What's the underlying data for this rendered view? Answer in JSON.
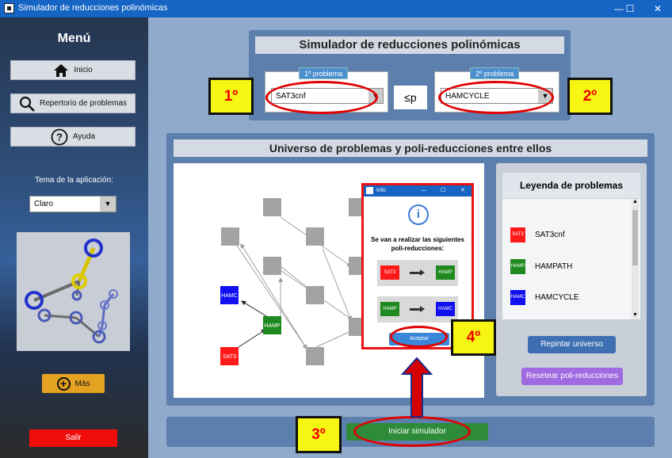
{
  "window": {
    "title": "Simulador de reducciones polinómicas",
    "controls": [
      "—",
      "☐",
      "✕"
    ]
  },
  "sidebar": {
    "title": "Menú",
    "buttons": [
      {
        "label": "Inicio",
        "icon": "home-icon"
      },
      {
        "label": "Repertorio de problemas",
        "icon": "search-icon"
      },
      {
        "label": "Ayuda",
        "icon": "help-icon"
      }
    ],
    "theme_label": "Tema de la aplicación:",
    "theme_value": "Claro",
    "more_label": "Más",
    "exit_label": "Salir"
  },
  "top_panel": {
    "title": "Simulador de reducciones polinómicas",
    "problem1_tag": "1º problema",
    "problem1_value": "SAT3cnf",
    "reduction_symbol": "≤p",
    "problem2_tag": "2º problema",
    "problem2_value": "HAMCYCLE"
  },
  "universe": {
    "title": "Universo de problemas y poli-reducciones entre ellos",
    "nodes": {
      "hamc": "HAMC",
      "hamp": "HAMP",
      "sat3": "SAT3"
    }
  },
  "legend": {
    "title": "Leyenda de problemas",
    "items": [
      {
        "abbr": "SAT3",
        "label": "SAT3cnf",
        "color": "#ff1a1a"
      },
      {
        "abbr": "HAMP",
        "label": "HAMPATH",
        "color": "#1f8a1f"
      },
      {
        "abbr": "HAMC",
        "label": "HAMCYCLE",
        "color": "#1010f0"
      }
    ],
    "repaint_label": "Repintar universo",
    "reset_label": "Resetear poli-reducciones"
  },
  "start_label": "Iniciar simulador",
  "dialog": {
    "title": "Info",
    "controls": [
      "—",
      "☐",
      "✕"
    ],
    "info_glyph": "i",
    "message": "Se van a realizar las siguientes poli-reducciones:",
    "reductions": [
      {
        "from": "SAT3",
        "to": "HAMP"
      },
      {
        "from": "HAMP",
        "to": "HAMC"
      }
    ],
    "ok_label": "Aceptar"
  },
  "badges": [
    "1º",
    "2º",
    "3º",
    "4º"
  ],
  "colors": {
    "accent": "#1664c3",
    "sat3": "#ff1a1a",
    "hamp": "#1f8a1f",
    "hamc": "#1010f0",
    "annotation": "#e10000",
    "badge": "#f6f612"
  }
}
